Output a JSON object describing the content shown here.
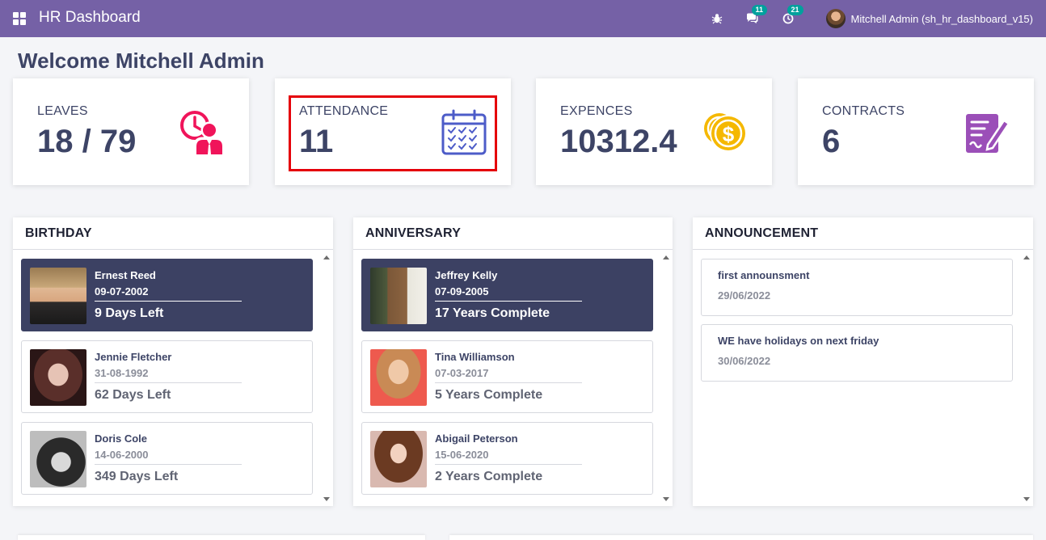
{
  "app": {
    "title": "HR Dashboard"
  },
  "navbar": {
    "chat_badge": "11",
    "activity_badge": "21",
    "user_name": "Mitchell Admin (sh_hr_dashboard_v15)"
  },
  "welcome": "Welcome Mitchell Admin",
  "stats": {
    "leaves": {
      "label": "LEAVES",
      "value": "18 / 79",
      "color": "#f0145a"
    },
    "attendance": {
      "label": "ATTENDANCE",
      "value": "11",
      "color": "#4d5cc8"
    },
    "expences": {
      "label": "EXPENCES",
      "value": "10312.4",
      "color": "#f5b800"
    },
    "contracts": {
      "label": "CONTRACTS",
      "value": "6",
      "color": "#9b4fb8"
    }
  },
  "birthday": {
    "title": "BIRTHDAY",
    "items": [
      {
        "name": "Ernest Reed",
        "date": "09-07-2002",
        "info": "9 Days Left"
      },
      {
        "name": "Jennie Fletcher",
        "date": "31-08-1992",
        "info": "62 Days Left"
      },
      {
        "name": "Doris Cole",
        "date": "14-06-2000",
        "info": "349 Days Left"
      }
    ]
  },
  "anniversary": {
    "title": "ANNIVERSARY",
    "items": [
      {
        "name": "Jeffrey Kelly",
        "date": "07-09-2005",
        "info": "17 Years Complete"
      },
      {
        "name": "Tina Williamson",
        "date": "07-03-2017",
        "info": "5 Years Complete"
      },
      {
        "name": "Abigail Peterson",
        "date": "15-06-2020",
        "info": "2 Years Complete"
      }
    ]
  },
  "announcement": {
    "title": "ANNOUNCEMENT",
    "items": [
      {
        "title": "first announsment",
        "date": "29/06/2022"
      },
      {
        "title": "WE have holidays on next friday",
        "date": "30/06/2022"
      }
    ]
  }
}
